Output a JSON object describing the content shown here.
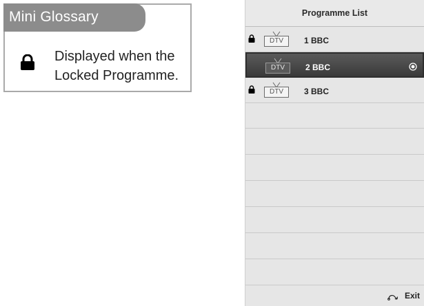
{
  "glossary": {
    "title": "Mini Glossary",
    "icon": "lock-icon",
    "description": "Displayed when the Locked Programme."
  },
  "programme_list": {
    "title": "Programme List",
    "rows": [
      {
        "locked": true,
        "type": "DTV",
        "name": "1 BBC",
        "selected": false
      },
      {
        "locked": false,
        "type": "DTV",
        "name": "2 BBC",
        "selected": true
      },
      {
        "locked": true,
        "type": "DTV",
        "name": "3 BBC",
        "selected": false
      }
    ],
    "exit_label": "Exit",
    "exit_icon": "return-arrow-icon"
  },
  "colors": {
    "tab": "#8c8c8c",
    "panel": "#e6e6e6",
    "selected_row": "#3a3a3a"
  }
}
